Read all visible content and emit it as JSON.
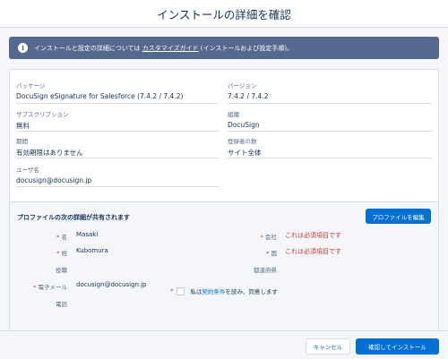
{
  "header": {
    "title": "インストールの詳細を確認"
  },
  "banner": {
    "icon": "info-icon",
    "text_before": "インストールと設定の詳細については ",
    "link": "カスタマイズガイド",
    "text_after": " (インストールおよび設定手順)。"
  },
  "details": {
    "package_label": "パッケージ",
    "package_value": "DocuSign eSignature for Salesforce (7.4.2 / 7.4.2)",
    "version_label": "バージョン",
    "version_value": "7.4.2 / 7.4.2",
    "subscription_label": "サブスクリプション",
    "subscription_value": "無料",
    "org_label": "組織",
    "org_value": "DocuSign",
    "expiry_label": "期間",
    "expiry_value": "有効期限はありません",
    "seats_label": "登録者の数",
    "seats_value": "サイト全体",
    "username_label": "ユーザ名",
    "username_value": "docusign@docusign.jp"
  },
  "profile": {
    "title": "プロファイルの次の詳細が共有されます",
    "edit_button": "プロファイルを編集",
    "required_mark": "*",
    "first_name_label": "名",
    "first_name_value": "Masaki",
    "last_name_label": "姓",
    "last_name_value": "Kubomura",
    "title_label": "役職",
    "email_label": "電子メール",
    "email_value": "docusign@docusign.jp",
    "phone_label": "電話",
    "company_label": "会社",
    "company_error": "これは必須項目です",
    "country_label": "国",
    "country_error": "これは必須項目です",
    "state_label": "都道府県"
  },
  "terms": {
    "required_mark": "*",
    "text_before": "私は",
    "link": "契約条件",
    "text_after": "を読み、同意します"
  },
  "footer": {
    "cancel_label": "キャンセル",
    "confirm_label": "確認してインストール"
  }
}
